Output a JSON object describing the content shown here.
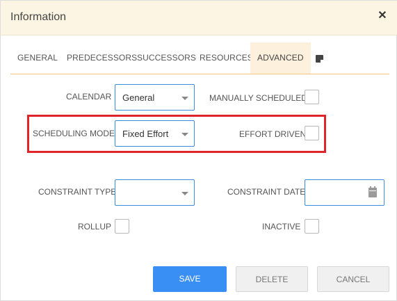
{
  "dialog": {
    "title": "Information",
    "close_icon": "close-icon"
  },
  "tabs": [
    {
      "label": "GENERAL",
      "active": false
    },
    {
      "label": "PREDECESSORS",
      "active": false
    },
    {
      "label": "SUCCESSORS",
      "active": false
    },
    {
      "label": "RESOURCES",
      "active": false
    },
    {
      "label": "ADVANCED",
      "active": true
    },
    {
      "icon": "notes-icon",
      "active": false
    }
  ],
  "form": {
    "calendar": {
      "label": "CALENDAR",
      "value": "General"
    },
    "manually_scheduled": {
      "label": "MANUALLY SCHEDULED",
      "checked": false
    },
    "scheduling_mode": {
      "label": "SCHEDULING MODE",
      "value": "Fixed Effort"
    },
    "effort_driven": {
      "label": "EFFORT DRIVEN",
      "checked": false
    },
    "constraint_type": {
      "label": "CONSTRAINT TYPE",
      "value": ""
    },
    "constraint_date": {
      "label": "CONSTRAINT DATE",
      "value": "",
      "icon": "calendar-icon"
    },
    "rollup": {
      "label": "ROLLUP",
      "checked": false
    },
    "inactive": {
      "label": "INACTIVE",
      "checked": false
    }
  },
  "buttons": {
    "save": "SAVE",
    "delete": "DELETE",
    "cancel": "CANCEL"
  },
  "colors": {
    "header_bg": "#fdf5e4",
    "accent_blue": "#3a8ff5",
    "highlight_red": "#e0242a",
    "tab_underline": "#f0c67a"
  }
}
